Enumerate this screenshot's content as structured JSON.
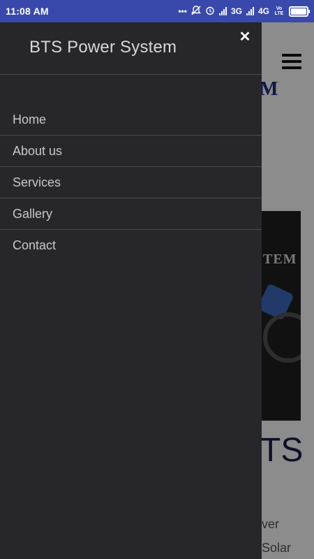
{
  "status_bar": {
    "time": "11:08 AM",
    "network_1": "3G",
    "network_2": "4G",
    "volte": "Vo LTE",
    "icons": [
      "more-dots-icon",
      "notifications-off-icon",
      "alarm-icon",
      "signal-icon",
      "signal-icon",
      "battery-icon"
    ]
  },
  "background_page": {
    "logo_fragment": "M",
    "hero_fragment": "TEM",
    "heading_fragment": "TS",
    "text_line_1": "ver",
    "text_line_2": "Solar"
  },
  "drawer": {
    "title": "BTS Power System",
    "close_glyph": "✕",
    "items": [
      {
        "label": "Home"
      },
      {
        "label": "About us"
      },
      {
        "label": "Services"
      },
      {
        "label": "Gallery"
      },
      {
        "label": "Contact"
      }
    ]
  },
  "colors": {
    "status_bar": "#3949ab",
    "drawer": "#26262b",
    "menu_text": "#c8c8cc",
    "logo_blue": "#1b2a7a"
  }
}
